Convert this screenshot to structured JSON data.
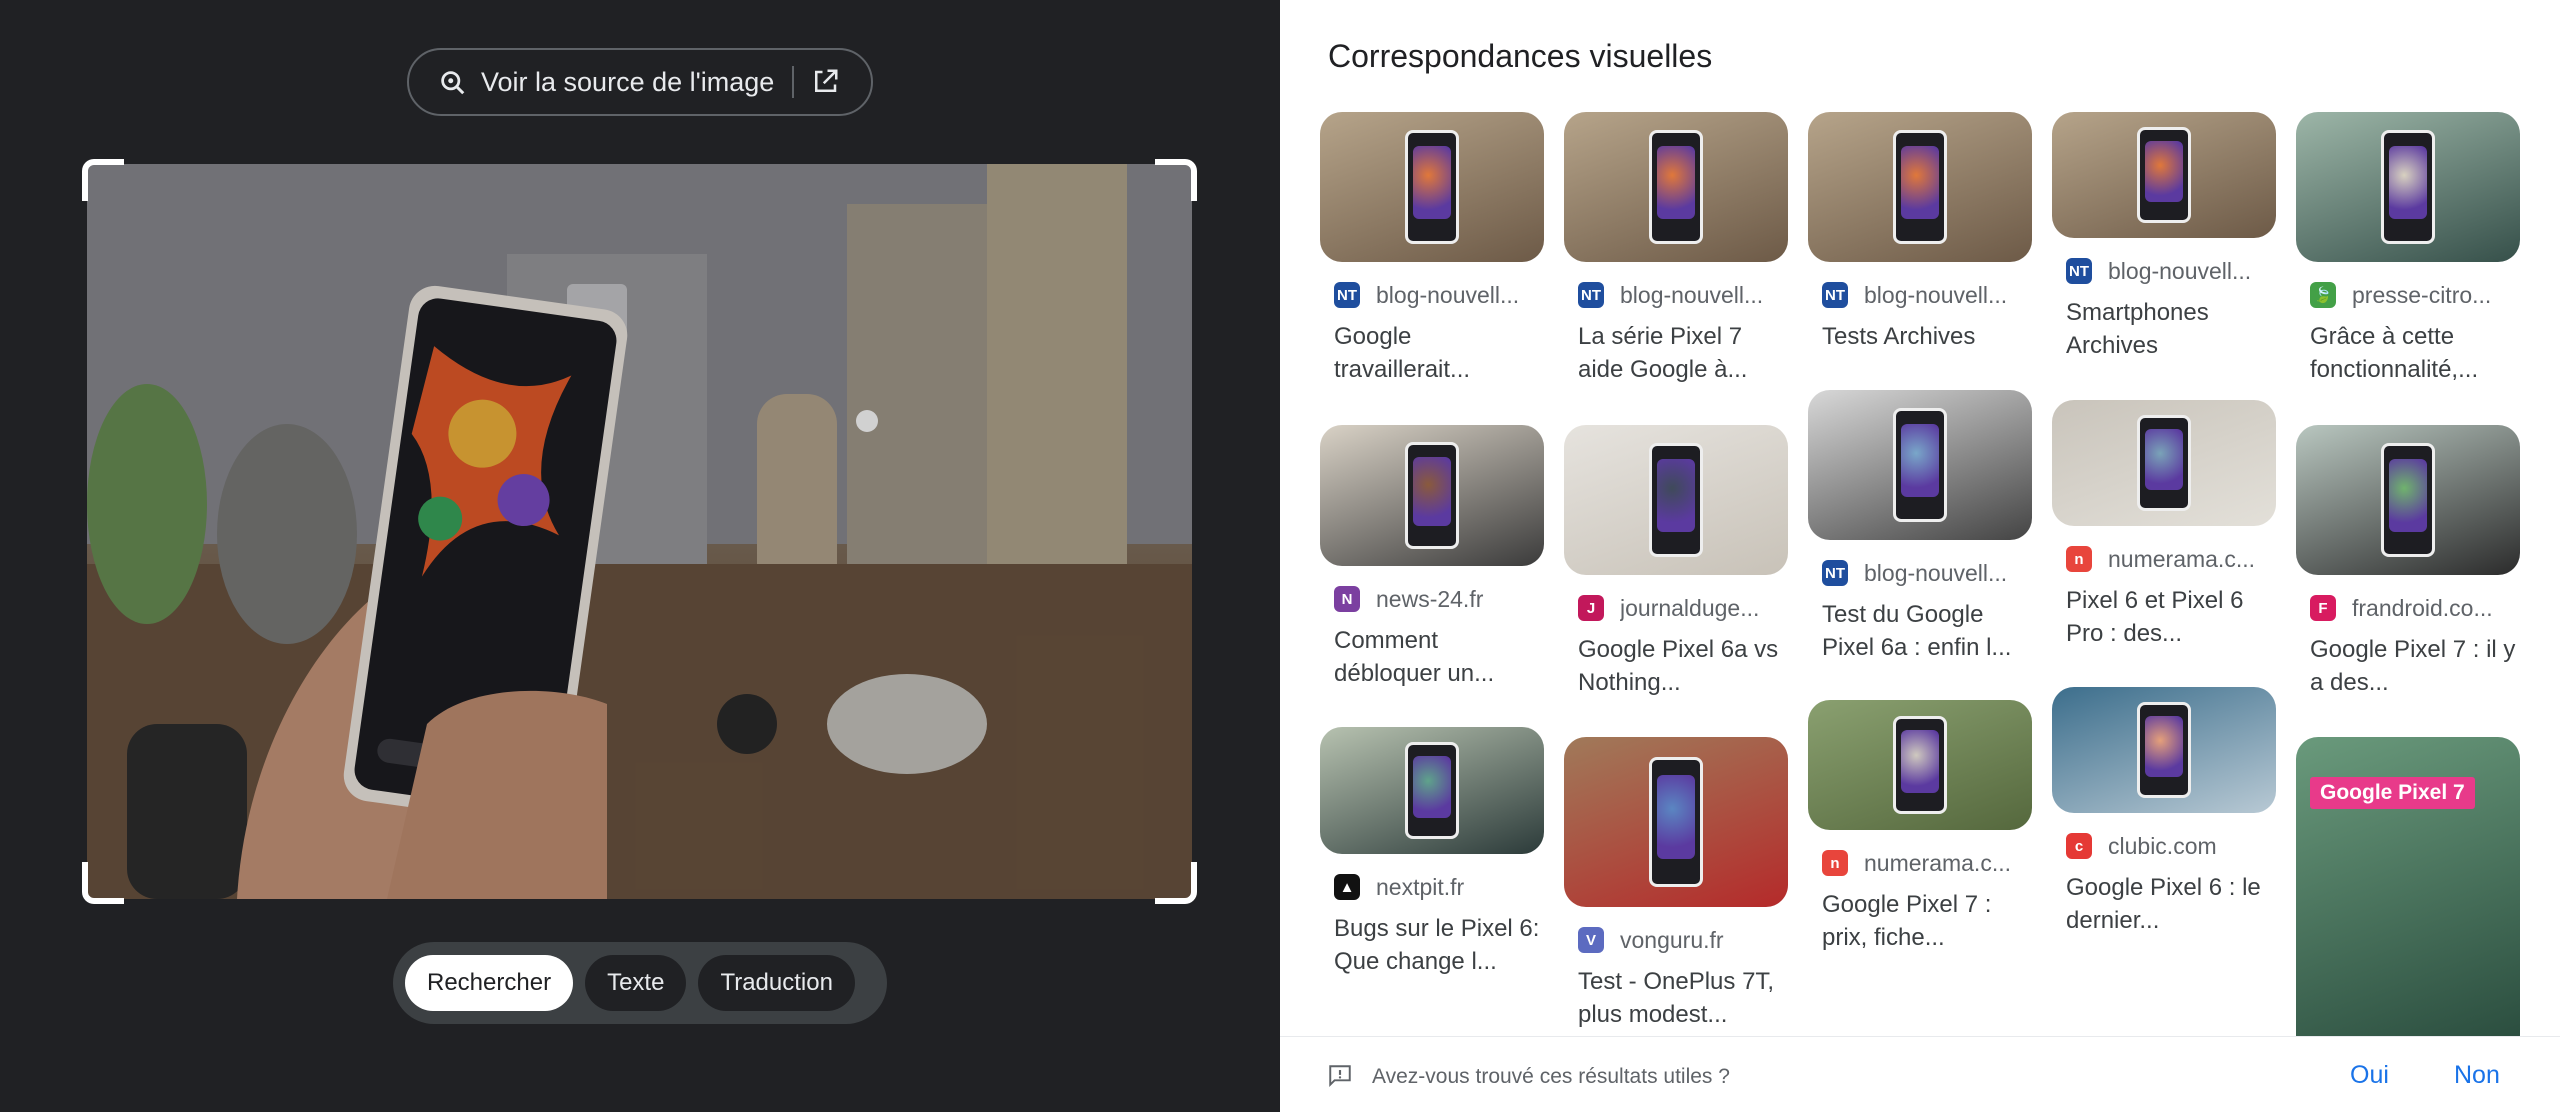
{
  "left": {
    "source_button": {
      "label": "Voir la source de l'image",
      "lens_icon": "lens-icon",
      "external_icon": "open-in-new-icon"
    },
    "modes": [
      "Rechercher",
      "Texte",
      "Traduction"
    ],
    "active_mode": "Rechercher"
  },
  "right": {
    "title": "Correspondances visuelles",
    "feedback": {
      "question": "Avez-vous trouvé ces résultats utiles ?",
      "yes": "Oui",
      "no": "Non"
    },
    "results": [
      {
        "site": "blog-nouvell...",
        "title": "Google travaillerait...",
        "favicon": "NT",
        "fav_color": "#1f4e9e"
      },
      {
        "site": "news-24.fr",
        "title": "Comment débloquer un...",
        "favicon": "N",
        "fav_color": "#7b3fa0"
      },
      {
        "site": "nextpit.fr",
        "title": "Bugs sur le Pixel 6: Que change l...",
        "favicon": "▲",
        "fav_color": "#111111"
      },
      {
        "site": "blog-nouvell...",
        "title": "La série Pixel 7 aide Google à...",
        "favicon": "NT",
        "fav_color": "#1f4e9e"
      },
      {
        "site": "journalduge...",
        "title": "Google Pixel 6a vs Nothing...",
        "favicon": "J",
        "fav_color": "#c2185b"
      },
      {
        "site": "vonguru.fr",
        "title": "Test - OnePlus 7T, plus modest...",
        "favicon": "V",
        "fav_color": "#5c6bc0"
      },
      {
        "site": "blog-nouvell...",
        "title": "Tests Archives",
        "favicon": "NT",
        "fav_color": "#1f4e9e"
      },
      {
        "site": "blog-nouvell...",
        "title": "Test du Google Pixel 6a : enfin l...",
        "favicon": "NT",
        "fav_color": "#1f4e9e"
      },
      {
        "site": "numerama.c...",
        "title": "Google Pixel 7 : prix, fiche...",
        "favicon": "n",
        "fav_color": "#e8453c"
      },
      {
        "site": "blog-nouvell...",
        "title": "Smartphones Archives",
        "favicon": "NT",
        "fav_color": "#1f4e9e"
      },
      {
        "site": "numerama.c...",
        "title": "Pixel 6 et Pixel 6 Pro : des...",
        "favicon": "n",
        "fav_color": "#e8453c"
      },
      {
        "site": "clubic.com",
        "title": "Google Pixel 6 : le dernier...",
        "favicon": "c",
        "fav_color": "#e53935"
      },
      {
        "site": "presse-citro...",
        "title": "Grâce à cette fonctionnalité,...",
        "favicon": "🍃",
        "fav_color": "#43a047"
      },
      {
        "site": "frandroid.co...",
        "title": "Google Pixel 7 : il y a des...",
        "favicon": "F",
        "fav_color": "#d81b60"
      }
    ],
    "overlay_badge": "Google Pixel 7"
  },
  "colors": {
    "link": "#1a73e8",
    "dark_bg": "#202124"
  }
}
